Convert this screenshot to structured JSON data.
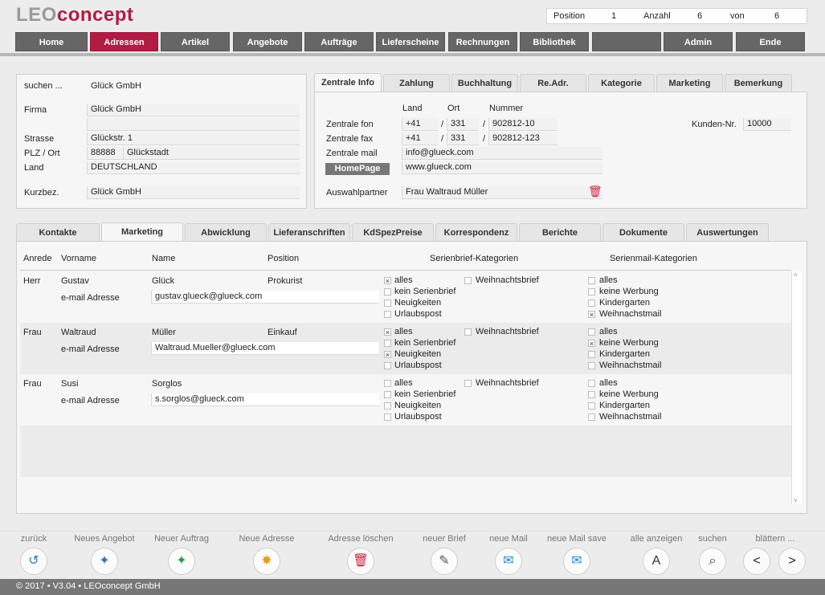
{
  "app": {
    "logo_leo": "LEO",
    "logo_concept": "concept"
  },
  "position_bar": {
    "position_label": "Position",
    "position_value": "1",
    "anzahl_label": "Anzahl",
    "anzahl_value": "6",
    "von_label": "von",
    "von_value": "6"
  },
  "nav": [
    "Home",
    "Adressen",
    "Artikel",
    "Angebote",
    "Aufträge",
    "Lieferscheine",
    "Rechnungen",
    "Bibliothek",
    "",
    "Admin",
    "Ende"
  ],
  "address": {
    "suchen_label": "suchen ...",
    "suchen_value": "Glück GmbH",
    "firma_label": "Firma",
    "firma_value": "Glück GmbH",
    "firma2_value": "",
    "strasse_label": "Strasse",
    "strasse_value": "Glückstr. 1",
    "plzort_label": "PLZ / Ort",
    "plz_value": "88888",
    "ort_value": "Glückstadt",
    "land_label": "Land",
    "land_value": "DEUTSCHLAND",
    "kurzbez_label": "Kurzbez.",
    "kurzbez_value": "Glück GmbH"
  },
  "info_tabs": [
    "Zentrale Info",
    "Zahlung",
    "Buchhaltung",
    "Re.Adr.",
    "Kategorie",
    "Marketing",
    "Bemerkung"
  ],
  "zentrale": {
    "col_land": "Land",
    "col_ort": "Ort",
    "col_nummer": "Nummer",
    "fon_label": "Zentrale fon",
    "fon_land": "+41",
    "fon_ort": "331",
    "fon_nummer": "902812-10",
    "fax_label": "Zentrale fax",
    "fax_land": "+41",
    "fax_ort": "331",
    "fax_nummer": "902812-123",
    "mail_label": "Zentrale mail",
    "mail_value": "info@glueck.com",
    "homepage_btn": "HomePage",
    "homepage_value": "www.glueck.com",
    "auswahl_label": "Auswahlpartner",
    "auswahl_value": "Frau Waltraud Müller",
    "kunden_label": "Kunden-Nr.",
    "kunden_value": "10000",
    "slash": "/"
  },
  "contact_tabs": [
    "Kontakte",
    "Marketing",
    "Abwicklung",
    "Lieferanschriften",
    "KdSpezPreise",
    "Korrespondenz",
    "Berichte",
    "Dokumente",
    "Auswertungen"
  ],
  "contacts_header": {
    "anrede": "Anrede",
    "vorname": "Vorname",
    "name": "Name",
    "position": "Position",
    "serienbrief": "Serienbrief-Kategorien",
    "serienmail": "Serienmail-Kategorien"
  },
  "contacts": [
    {
      "anrede": "Herr",
      "vorname": "Gustav",
      "name": "Glück",
      "position": "Prokurist",
      "email_label": "e-mail Adresse",
      "email": "gustav.glueck@glueck.com",
      "brief": [
        {
          "label": "alles",
          "checked": true
        },
        {
          "label": "kein Serienbrief",
          "checked": false
        },
        {
          "label": "Neuigkeiten",
          "checked": false
        },
        {
          "label": "Urlaubspost",
          "checked": false
        }
      ],
      "weihnachtsbrief": {
        "label": "Weihnachtsbrief",
        "checked": false
      },
      "mail": [
        {
          "label": "alles",
          "checked": false
        },
        {
          "label": "keine Werbung",
          "checked": false
        },
        {
          "label": "Kindergarten",
          "checked": false
        },
        {
          "label": "Weihnachstmail",
          "checked": true
        }
      ]
    },
    {
      "anrede": "Frau",
      "vorname": "Waltraud",
      "name": "Müller",
      "position": "Einkauf",
      "email_label": "e-mail Adresse",
      "email": "Waltraud.Mueller@glueck.com",
      "brief": [
        {
          "label": "alles",
          "checked": true
        },
        {
          "label": "kein Serienbrief",
          "checked": false
        },
        {
          "label": "Neuigkeiten",
          "checked": true
        },
        {
          "label": "Urlaubspost",
          "checked": false
        }
      ],
      "weihnachtsbrief": {
        "label": "Weihnachtsbrief",
        "checked": false
      },
      "mail": [
        {
          "label": "alles",
          "checked": false
        },
        {
          "label": "keine Werbung",
          "checked": true
        },
        {
          "label": "Kindergarten",
          "checked": false
        },
        {
          "label": "Weihnachstmail",
          "checked": false
        }
      ]
    },
    {
      "anrede": "Frau",
      "vorname": "Susi",
      "name": "Sorglos",
      "position": "",
      "email_label": "e-mail Adresse",
      "email": "s.sorglos@glueck.com",
      "brief": [
        {
          "label": "alles",
          "checked": false
        },
        {
          "label": "kein Serienbrief",
          "checked": false
        },
        {
          "label": "Neuigkeiten",
          "checked": false
        },
        {
          "label": "Urlaubspost",
          "checked": false
        }
      ],
      "weihnachtsbrief": {
        "label": "Weihnachtsbrief",
        "checked": false
      },
      "mail": [
        {
          "label": "alles",
          "checked": false
        },
        {
          "label": "keine Werbung",
          "checked": false
        },
        {
          "label": "Kindergarten",
          "checked": false
        },
        {
          "label": "Weihnachstmail",
          "checked": false
        }
      ]
    }
  ],
  "toolbar": [
    {
      "label": "zurück",
      "icon": "back-arrow-icon",
      "glyph": "↺"
    },
    {
      "label": "Neues Angebot",
      "icon": "new-offer-icon",
      "glyph": "✦"
    },
    {
      "label": "Neuer Auftrag",
      "icon": "new-order-icon",
      "glyph": "✦"
    },
    {
      "label": "Neue Adresse",
      "icon": "new-address-icon",
      "glyph": "✸"
    },
    {
      "label": "Adresse löschen",
      "icon": "trash-icon",
      "glyph": "🗑"
    },
    {
      "label": "neuer Brief",
      "icon": "letter-icon",
      "glyph": "✎"
    },
    {
      "label": "neue Mail",
      "icon": "mail-icon",
      "glyph": "✉"
    },
    {
      "label": "neue Mail save",
      "icon": "mail-save-icon",
      "glyph": "✉"
    },
    {
      "label": "alle anzeigen",
      "icon": "show-all-icon",
      "glyph": "A"
    },
    {
      "label": "suchen",
      "icon": "search-icon",
      "glyph": "⌕"
    },
    {
      "label": "blättern ...",
      "icon": "browse-icon",
      "glyph": ""
    }
  ],
  "nav_prev": "<",
  "nav_next": ">",
  "footer": "© 2017 • V3.04 • LEOconcept GmbH",
  "colors": {
    "accent": "#b01c44",
    "nav": "#666666"
  }
}
